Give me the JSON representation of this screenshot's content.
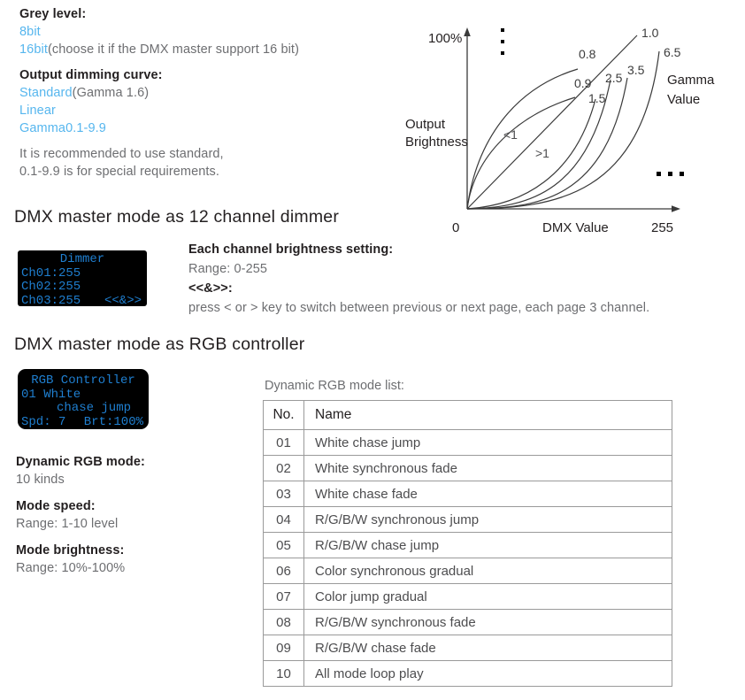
{
  "spec": {
    "grey_level_heading": "Grey level:",
    "grey_level_options": [
      "8bit",
      "16bit"
    ],
    "grey_level_note": "(choose it if the DMX master support 16 bit)",
    "dimming_curve_heading": "Output dimming curve:",
    "dimming_curve_option_1": "Standard",
    "dimming_curve_option_1_note": "(Gamma 1.6)",
    "dimming_curve_option_2": "Linear",
    "dimming_curve_option_3": "Gamma0.1-9.9",
    "recommend_line_1": "It is recommended to use standard,",
    "recommend_line_2": "0.1-9.9 is for special requirements."
  },
  "colors": {
    "blue": "#56b6ee",
    "grey": "#6d6e71",
    "dark": "#231f20",
    "lcd_text": "#1f7fd0",
    "lcd_bg": "#000000",
    "table_border": "#9a9a9a"
  },
  "dimmer_section": {
    "heading": "DMX master mode as 12 channel dimmer",
    "lcd": {
      "title": "Dimmer",
      "rows": [
        {
          "label": "Ch01:255",
          "right": ""
        },
        {
          "label": "Ch02:255",
          "right": ""
        },
        {
          "label": "Ch03:255",
          "right": "<<&>>"
        }
      ]
    },
    "desc": {
      "heading": "Each channel brightness setting:",
      "range": "Range: 0-255",
      "keys_heading": "<<&>>:",
      "keys_note": "press < or > key to switch between previous or next page, each page 3 channel."
    }
  },
  "rgb_section": {
    "heading": "DMX master mode as RGB controller",
    "lcd": {
      "title": "RGB Controller",
      "line2": "01 White",
      "line3": "chase jump",
      "speed": "Spd: 7",
      "brightness": "Brt:100%"
    },
    "params": [
      {
        "heading": "Dynamic RGB mode:",
        "value": "10 kinds"
      },
      {
        "heading": "Mode speed:",
        "value": "Range: 1-10 level"
      },
      {
        "heading": "Mode brightness:",
        "value": "Range: 10%-100%"
      }
    ],
    "mode_list_caption": "Dynamic RGB mode list:",
    "mode_table": {
      "headers": [
        "No.",
        "Name"
      ],
      "rows": [
        {
          "no": "01",
          "name": "White chase jump"
        },
        {
          "no": "02",
          "name": "White synchronous fade"
        },
        {
          "no": "03",
          "name": "White chase fade"
        },
        {
          "no": "04",
          "name": "R/G/B/W synchronous jump"
        },
        {
          "no": "05",
          "name": "R/G/B/W chase jump"
        },
        {
          "no": "06",
          "name": "Color synchronous gradual"
        },
        {
          "no": "07",
          "name": "Color jump gradual"
        },
        {
          "no": "08",
          "name": "R/G/B/W synchronous fade"
        },
        {
          "no": "09",
          "name": "R/G/B/W chase fade"
        },
        {
          "no": "10",
          "name": "All mode loop play"
        }
      ]
    }
  },
  "chart_data": {
    "type": "line",
    "title": "",
    "xlabel": "DMX Value",
    "ylabel": "Output Brightness",
    "xlim": [
      0,
      255
    ],
    "ylim": [
      0,
      100
    ],
    "x_tick_labels": [
      "0",
      "255"
    ],
    "y_tick_labels": [
      "100%"
    ],
    "grid": false,
    "legend_title": "Gamma Value",
    "annotations": [
      "<1",
      ">1"
    ],
    "vertical_ellipsis": "⋮",
    "horizontal_ellipsis": "…",
    "series": [
      {
        "name": "0.8",
        "gamma": 0.8,
        "label": "0.8"
      },
      {
        "name": "0.9",
        "gamma": 0.9,
        "label": "0.9"
      },
      {
        "name": "1.0",
        "gamma": 1.0,
        "label": "1.0"
      },
      {
        "name": "1.5",
        "gamma": 1.5,
        "label": "1.5"
      },
      {
        "name": "2.5",
        "gamma": 2.5,
        "label": "2.5"
      },
      {
        "name": "3.5",
        "gamma": 3.5,
        "label": "3.5"
      },
      {
        "name": "6.5",
        "gamma": 6.5,
        "label": "6.5"
      }
    ]
  }
}
